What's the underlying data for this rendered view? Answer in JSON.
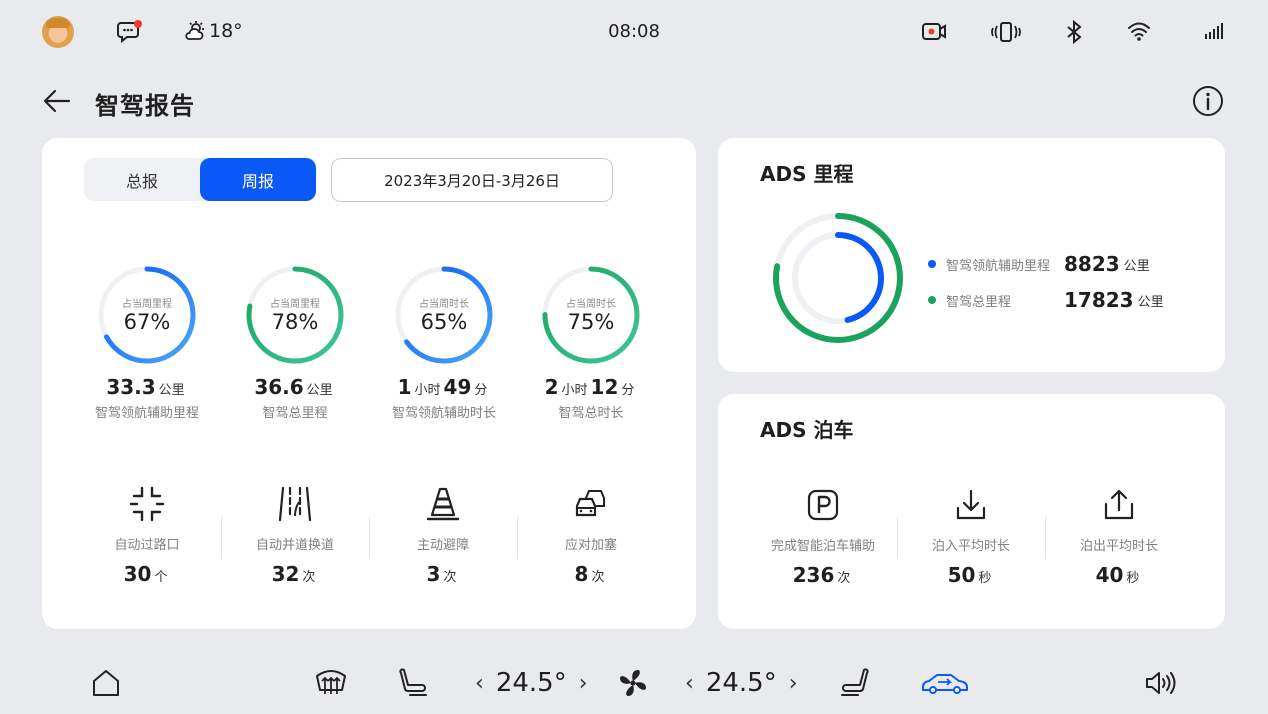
{
  "status": {
    "temperature": "18°",
    "time": "08:08"
  },
  "header": {
    "title": "智驾报告"
  },
  "report": {
    "tabs": [
      {
        "label": "总报",
        "active": false
      },
      {
        "label": "周报",
        "active": true
      }
    ],
    "date_range": "2023年3月20日-3月26日",
    "rings": [
      {
        "caption": "占当周里程",
        "percent_text": "67%",
        "fraction": 0.67,
        "color_start": "#0a59f7",
        "color_end": "#4aa8f5",
        "value": "33.3",
        "unit": "公里",
        "value2": "",
        "unit2": "",
        "label": "智驾领航辅助里程"
      },
      {
        "caption": "占当周里程",
        "percent_text": "78%",
        "fraction": 0.78,
        "color_start": "#1aa35c",
        "color_end": "#3ec79a",
        "value": "36.6",
        "unit": "公里",
        "value2": "",
        "unit2": "",
        "label": "智驾总里程"
      },
      {
        "caption": "占当周时长",
        "percent_text": "65%",
        "fraction": 0.65,
        "color_start": "#0a59f7",
        "color_end": "#4aa8f5",
        "value": "1",
        "unit": "小时",
        "value2": "49",
        "unit2": "分",
        "label": "智驾领航辅助时长"
      },
      {
        "caption": "占当周时长",
        "percent_text": "75%",
        "fraction": 0.75,
        "color_start": "#1aa35c",
        "color_end": "#3ec79a",
        "value": "2",
        "unit": "小时",
        "value2": "12",
        "unit2": "分",
        "label": "智驾总时长"
      }
    ],
    "features": [
      {
        "icon": "intersection-icon",
        "label": "自动过路口",
        "value": "30",
        "unit": "个"
      },
      {
        "icon": "lane-change-icon",
        "label": "自动并道换道",
        "value": "32",
        "unit": "次"
      },
      {
        "icon": "traffic-cone-icon",
        "label": "主动避障",
        "value": "3",
        "unit": "次"
      },
      {
        "icon": "traffic-jam-icon",
        "label": "应对加塞",
        "value": "8",
        "unit": "次"
      }
    ]
  },
  "mileage": {
    "title": "ADS 里程",
    "items": [
      {
        "label": "智驾领航辅助里程",
        "value": "8823",
        "unit": "公里",
        "color": "#0a59f7"
      },
      {
        "label": "智驾总里程",
        "value": "17823",
        "unit": "公里",
        "color": "#1aa35c"
      }
    ]
  },
  "parking": {
    "title": "ADS 泊车",
    "items": [
      {
        "icon": "parking-icon",
        "label": "完成智能泊车辅助",
        "value": "236",
        "unit": "次"
      },
      {
        "icon": "park-in-icon",
        "label": "泊入平均时长",
        "value": "50",
        "unit": "秒"
      },
      {
        "icon": "park-out-icon",
        "label": "泊出平均时长",
        "value": "40",
        "unit": "秒"
      }
    ]
  },
  "dock": {
    "left_temp": "24.5°",
    "right_temp": "24.5°",
    "accent": "#0a59f7"
  }
}
